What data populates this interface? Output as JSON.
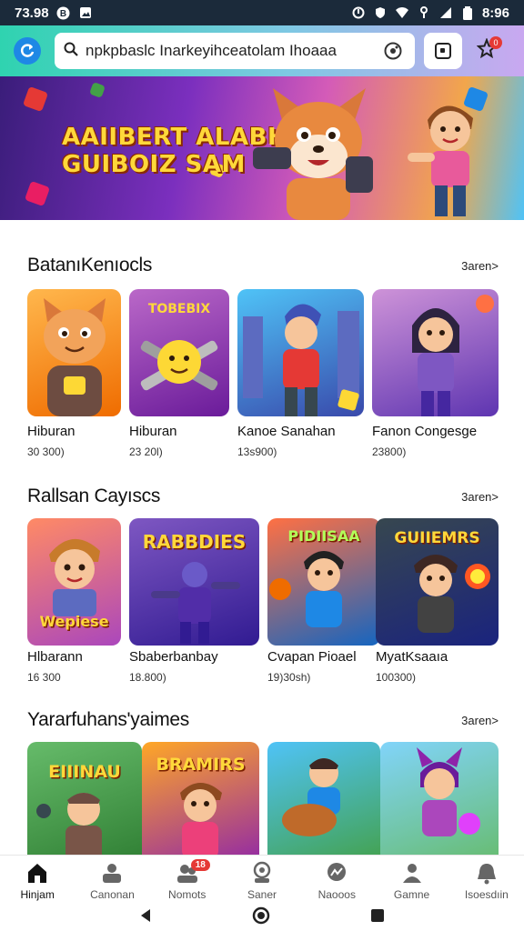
{
  "status_bar": {
    "time": "73.98",
    "battery_time": "8:96"
  },
  "header": {
    "search_value": "npkpbaslc Inarkeyihceatolam Ihoaaa",
    "notification_count": "0"
  },
  "banner": {
    "title_line1": "AAIIBERT ALABH",
    "title_line2": "GUIBOIZ SAM"
  },
  "sections": [
    {
      "title": "BatanıKenıocls",
      "more": "3aren>",
      "cards": [
        {
          "label": "Hiburan",
          "count": "30 300)"
        },
        {
          "label": "Hiburan",
          "count": "23 20l)"
        },
        {
          "label": "Kanoe Sanahan",
          "count": "13s900)"
        },
        {
          "label": "Fanon Congesge",
          "count": "23800)"
        }
      ]
    },
    {
      "title": "Rallsan Cayıscs",
      "more": "3aren>",
      "cards": [
        {
          "label": "Hlbarann",
          "count": "16 300",
          "art": "Wepiese"
        },
        {
          "label": "Sbaberbanbay",
          "count": "18.800)",
          "art": "RABBDIES"
        },
        {
          "label": "Cvapan Pioael",
          "count": "19)30sh)",
          "art": "PIDIISAA"
        },
        {
          "label": "MyatKsaaıa",
          "count": "100300)",
          "art": "GUIIEMRS"
        }
      ]
    },
    {
      "title": "Yararfuhans'yaimes",
      "more": "3aren>",
      "cards": [
        {
          "art": "EIIINAU"
        },
        {
          "art": "BRAMIRS"
        },
        {
          "art": ""
        },
        {
          "art": ""
        }
      ]
    }
  ],
  "bottom_nav": [
    {
      "label": "Hinjam",
      "icon": "home-icon",
      "active": true
    },
    {
      "label": "Canonan",
      "icon": "person-icon"
    },
    {
      "label": "Nomots",
      "icon": "people-icon",
      "badge": "18"
    },
    {
      "label": "Saner",
      "icon": "group-icon"
    },
    {
      "label": "Naooos",
      "icon": "chat-icon"
    },
    {
      "label": "Gamne",
      "icon": "user-icon"
    },
    {
      "label": "Isoesdıin",
      "icon": "notification-icon"
    }
  ],
  "colors": {
    "header_gradient_start": "#2fd3b0",
    "header_gradient_end": "#c9a8f0",
    "badge_red": "#e53935",
    "art_yellow": "#ffd83a"
  }
}
